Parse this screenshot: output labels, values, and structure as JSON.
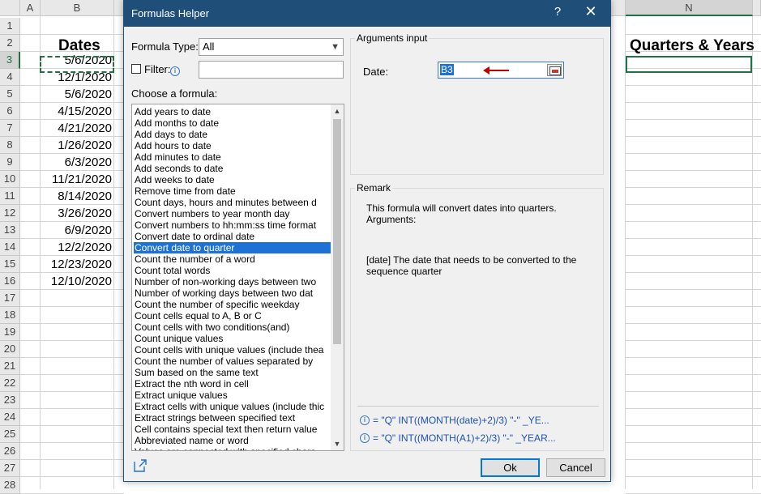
{
  "spreadsheet": {
    "columns": [
      "A",
      "B",
      "N"
    ],
    "rows": [
      "1",
      "2",
      "3",
      "4",
      "5",
      "6",
      "7",
      "8",
      "9",
      "10",
      "11",
      "12",
      "13",
      "14",
      "15",
      "16",
      "17",
      "18",
      "19",
      "20",
      "21",
      "22",
      "23",
      "24",
      "25",
      "26",
      "27",
      "28"
    ],
    "dates_header": "Dates",
    "dates": [
      "5/6/2020",
      "12/1/2020",
      "5/6/2020",
      "4/15/2020",
      "4/21/2020",
      "1/26/2020",
      "6/3/2020",
      "11/21/2020",
      "8/14/2020",
      "3/26/2020",
      "6/9/2020",
      "12/2/2020",
      "12/23/2020",
      "12/10/2020"
    ],
    "quarters_header": "Quarters & Years"
  },
  "dialog": {
    "title": "Formulas Helper",
    "help_label": "?",
    "close_label": "✕",
    "formula_type_label": "Formula Type:",
    "formula_type_value": "All",
    "filter_label": "Filter:",
    "choose_label": "Choose a formula:",
    "formulas": [
      "Add years to date",
      "Add months to date",
      "Add days to date",
      "Add hours to date",
      "Add minutes to date",
      "Add seconds to date",
      "Add weeks to date",
      "Remove time from date",
      "Count days, hours and minutes between d",
      "Convert numbers to year month day",
      "Convert numbers to hh:mm:ss time format",
      "Convert date to ordinal date",
      "Convert date to quarter",
      "Count the number of a word",
      "Count total words",
      "Number of non-working days between two",
      "Number of working days between two dat",
      "Count the number of specific weekday",
      "Count cells equal to A, B or C",
      "Count cells with two conditions(and)",
      "Count unique values",
      "Count cells with unique values (include thea",
      "Count the number of values separated by",
      "Sum based on the same text",
      "Extract the nth word in cell",
      "Extract unique values",
      "Extract cells with unique values (include thic",
      "Extract strings between specified text",
      "Cell contains special text then return value",
      "Abbreviated name or word",
      "Values are connected with specified chara"
    ],
    "selected_formula": "Convert date to quarter",
    "arguments_title": "Arguments input",
    "date_label": "Date:",
    "date_value": "B3",
    "remark_title": "Remark",
    "remark_line1": "This formula will convert dates into quarters.",
    "remark_line2": "Arguments:",
    "remark_line3": "[date] The date that needs to be converted to the",
    "remark_line4": "sequence quarter",
    "formula1": "= \"Q\" INT((MONTH(date)+2)/3)  \"-\" _YE...",
    "formula2": "= \"Q\" INT((MONTH(A1)+2)/3)  \"-\" _YEAR...",
    "ok_label": "Ok",
    "cancel_label": "Cancel"
  }
}
